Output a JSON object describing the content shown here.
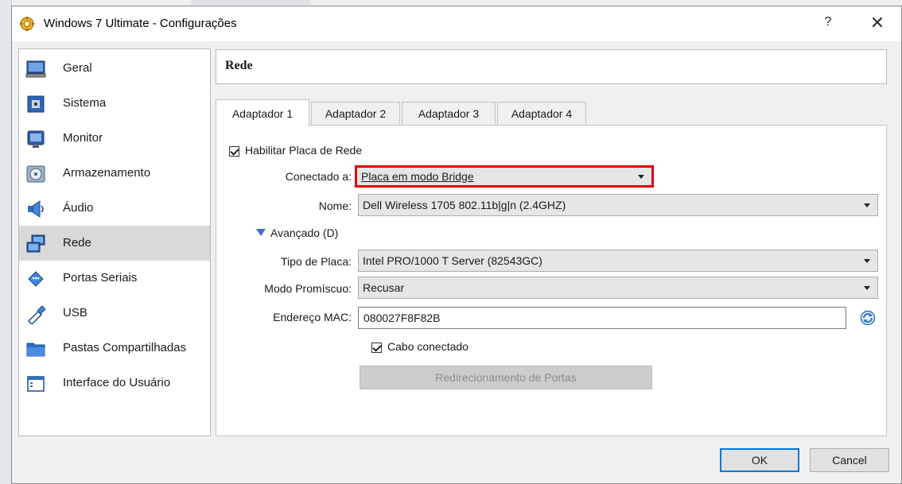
{
  "window": {
    "title": "Windows 7 Ultimate - Configurações",
    "help_label": "?",
    "close_label": "✕"
  },
  "sidebar": {
    "items": [
      {
        "label": "Geral",
        "icon": "monitor-computer-icon",
        "selected": false
      },
      {
        "label": "Sistema",
        "icon": "chip-icon",
        "selected": false
      },
      {
        "label": "Monitor",
        "icon": "display-icon",
        "selected": false
      },
      {
        "label": "Armazenamento",
        "icon": "disk-icon",
        "selected": false
      },
      {
        "label": "Áudio",
        "icon": "speaker-icon",
        "selected": false
      },
      {
        "label": "Rede",
        "icon": "network-icon",
        "selected": true
      },
      {
        "label": "Portas Seriais",
        "icon": "serial-port-icon",
        "selected": false
      },
      {
        "label": "USB",
        "icon": "usb-icon",
        "selected": false
      },
      {
        "label": "Pastas Compartilhadas",
        "icon": "shared-folder-icon",
        "selected": false
      },
      {
        "label": "Interface do Usuário",
        "icon": "user-interface-icon",
        "selected": false
      }
    ]
  },
  "panel": {
    "title": "Rede",
    "tabs": [
      {
        "label": "Adaptador 1",
        "active": true
      },
      {
        "label": "Adaptador 2",
        "active": false
      },
      {
        "label": "Adaptador 3",
        "active": false
      },
      {
        "label": "Adaptador 4",
        "active": false
      }
    ],
    "enable_label": "Habilitar Placa de Rede",
    "attached_label": "Conectado a:",
    "attached_value": "Placa em modo Bridge",
    "name_label": "Nome:",
    "name_value": "Dell Wireless 1705 802.11b|g|n (2.4GHZ)",
    "advanced_label": "Avançado (D)",
    "adapter_type_label": "Tipo de Placa:",
    "adapter_type_value": "Intel PRO/1000 T Server (82543GC)",
    "promisc_label": "Modo Promíscuo:",
    "promisc_value": "Recusar",
    "mac_label": "Endereço MAC:",
    "mac_value": "080027F8F82B",
    "cable_label": "Cabo conectado",
    "port_forwarding_label": "Redirecionamento de Portas"
  },
  "footer": {
    "ok_label": "OK",
    "cancel_label": "Cancel"
  },
  "colors": {
    "highlight_border": "#e00000",
    "selected_item": "#d9d9d9",
    "advanced_arrow": "#3b6fd6"
  }
}
